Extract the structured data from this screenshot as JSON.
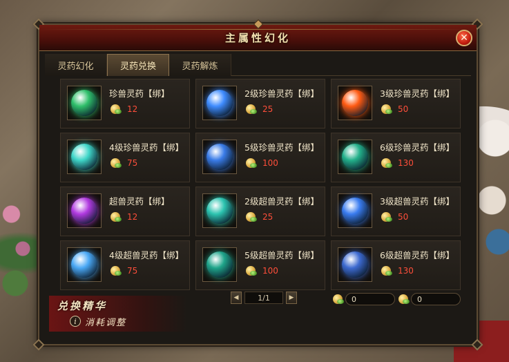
{
  "window": {
    "title": "主属性幻化",
    "close_label": "✕"
  },
  "tabs": [
    {
      "label": "灵药幻化",
      "active": false
    },
    {
      "label": "灵药兑换",
      "active": true
    },
    {
      "label": "灵药解炼",
      "active": false
    }
  ],
  "items": [
    {
      "name": "珍兽灵药【绑】",
      "price": "12",
      "color": "#2fbf6a"
    },
    {
      "name": "2级珍兽灵药【绑】",
      "price": "25",
      "color": "#3f8cff"
    },
    {
      "name": "3级珍兽灵药【绑】",
      "price": "50",
      "color": "#ff5a12"
    },
    {
      "name": "4级珍兽灵药【绑】",
      "price": "75",
      "color": "#3fd6c8"
    },
    {
      "name": "5级珍兽灵药【绑】",
      "price": "100",
      "color": "#3a7ce8"
    },
    {
      "name": "6级珍兽灵药【绑】",
      "price": "130",
      "color": "#23b08a"
    },
    {
      "name": "超兽灵药【绑】",
      "price": "12",
      "color": "#b13ae0"
    },
    {
      "name": "2级超兽灵药【绑】",
      "price": "25",
      "color": "#2cc4b0"
    },
    {
      "name": "3级超兽灵药【绑】",
      "price": "50",
      "color": "#3a7cf0"
    },
    {
      "name": "4级超兽灵药【绑】",
      "price": "75",
      "color": "#4aa8f5"
    },
    {
      "name": "5级超兽灵药【绑】",
      "price": "100",
      "color": "#1fa58a"
    },
    {
      "name": "6级超兽灵药【绑】",
      "price": "130",
      "color": "#3d6ad0"
    }
  ],
  "pager": {
    "prev": "◀",
    "info": "1/1",
    "next": "▶"
  },
  "currency": [
    {
      "value": "0"
    },
    {
      "value": "0"
    }
  ],
  "banner": {
    "title": "兑换精华",
    "info_icon": "i",
    "subtitle": "消耗调整"
  }
}
